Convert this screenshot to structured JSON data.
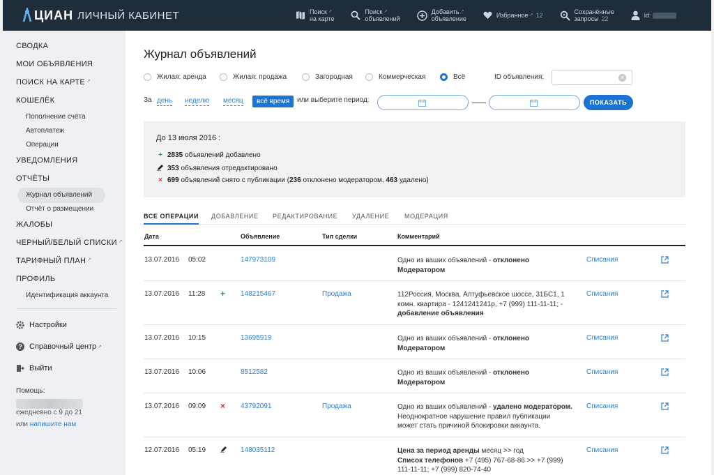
{
  "header": {
    "brand": "ЦИАН",
    "subtitle": "ЛИЧНЫЙ КАБИНЕТ",
    "nav": [
      {
        "icon": "map-icon",
        "line1": "Поиск",
        "line2": "на карте",
        "sup": "↗"
      },
      {
        "icon": "search-icon",
        "line1": "Поиск",
        "line2": "объявлений",
        "sup": "↗"
      },
      {
        "icon": "plus-circle-icon",
        "line1": "Добавить",
        "line2": "объявление",
        "sup": "↗"
      },
      {
        "icon": "heart-icon",
        "line1": "Избранное",
        "line2": "",
        "sup": "↗",
        "count": "12"
      },
      {
        "icon": "saved-search-icon",
        "line1": "Сохранённые",
        "line2": "запросы",
        "count": "22"
      },
      {
        "icon": "user-icon",
        "line1": "id:",
        "line2": ""
      }
    ]
  },
  "sidebar": {
    "items": [
      {
        "label": "СВОДКА"
      },
      {
        "label": "МОИ ОБЪЯВЛЕНИЯ"
      },
      {
        "label": "ПОИСК НА КАРТЕ",
        "sup": "↗"
      },
      {
        "label": "КОШЕЛЁК"
      },
      {
        "label": "Пополнение счёта"
      },
      {
        "label": "Автоплатеж"
      },
      {
        "label": "Операции"
      },
      {
        "label": "УВЕДОМЛЕНИЯ"
      },
      {
        "label": "ОТЧЁТЫ"
      },
      {
        "label": "Журнал объявлений"
      },
      {
        "label": "Отчёт о размещении"
      },
      {
        "label": "ЖАЛОБЫ"
      },
      {
        "label": "ЧЕРНЫЙ/БЕЛЫЙ СПИСКИ",
        "sup": "↗"
      },
      {
        "label": "ТАРИФНЫЙ ПЛАН",
        "sup": "↗"
      },
      {
        "label": "ПРОФИЛЬ"
      },
      {
        "label": "Идентификация аккаунта"
      }
    ],
    "tools": [
      {
        "icon": "gear-icon",
        "label": "Настройки"
      },
      {
        "icon": "help-icon",
        "label": "Справочный центр",
        "sup": "↗"
      },
      {
        "icon": "exit-icon",
        "label": "Выйти"
      }
    ],
    "help": {
      "title": "Помощь:",
      "hours": "ежедневно с 9 до 21",
      "or": "или",
      "write_link": "напишите нам"
    }
  },
  "main": {
    "title": "Журнал объявлений",
    "filters": [
      {
        "label": "Жилая: аренда",
        "checked": false
      },
      {
        "label": "Жилая: продажа",
        "checked": false
      },
      {
        "label": "Загородная",
        "checked": false
      },
      {
        "label": "Коммерческая",
        "checked": false
      },
      {
        "label": "Всё",
        "checked": true
      }
    ],
    "id_label": "ID объявления:",
    "id_value": "",
    "period": {
      "prefix": "За",
      "day": "день",
      "week": "неделю",
      "month": "месяц",
      "all": "всё время",
      "or_select": "или выберите период:",
      "show_button": "ПОКАЗАТЬ"
    },
    "summary": {
      "date": "До 13 июля 2016 :",
      "added_count": "2835",
      "added_text": "объявлений добавлено",
      "edited_count": "353",
      "edited_text": "объявления отредактировано",
      "removed_count": "699",
      "removed_text": "объявлений снято с публикации (",
      "rejected_count": "236",
      "rejected_text": "отклонено модератором,",
      "deleted_count": "463",
      "deleted_text": "удалено)"
    },
    "tabs": [
      "ВСЕ ОПЕРАЦИИ",
      "ДОБАВЛЕНИЕ",
      "РЕДАКТИРОВАНИЕ",
      "УДАЛЕНИЕ",
      "МОДЕРАЦИЯ"
    ],
    "columns": [
      "Дата",
      "Объявление",
      "Тип сделки",
      "Комментарий"
    ],
    "rows": [
      {
        "date": "13.07.2016",
        "time": "05:02",
        "mark": "",
        "id": "147973109",
        "deal": "",
        "c1": "Одно из ваших объявлений - ",
        "c1b": "отклонено",
        "c2b": "Модератором",
        "c3": "",
        "writeoff": "Списания"
      },
      {
        "date": "13.07.2016",
        "time": "11:28",
        "mark": "+",
        "id": "148215467",
        "deal": "Продажа",
        "c1": "112Россия, Москва, Алтуфьевское шоссе, 31БС1, 1",
        "c2": "комн. квартира - 1241241241р, +7 (999) 111-11-11; -",
        "c3b": "добавление объявления",
        "writeoff": "Списания"
      },
      {
        "date": "13.07.2016",
        "time": "10:15",
        "mark": "",
        "id": "13695919",
        "deal": "",
        "c1": "Одно из ваших объявлений - ",
        "c1b": "отклонено",
        "c2b": "Модератором",
        "writeoff": "Списания"
      },
      {
        "date": "13.07.2016",
        "time": "10:06",
        "mark": "",
        "id": "8512582",
        "deal": "",
        "c1": "Одно из ваших объявлений - ",
        "c1b": "отклонено",
        "c2b": "Модератором",
        "writeoff": "Списания"
      },
      {
        "date": "13.07.2016",
        "time": "09:09",
        "mark": "×",
        "id": "43792091",
        "deal": "Продажа",
        "c1": "Одно из ваших объявлений - ",
        "c1b": "удалено модератором.",
        "c2": "Неоднократное нарушение правил публикации",
        "c3": "может стать причиной блокировки аккаунта.",
        "writeoff": "Списания"
      },
      {
        "date": "12.07.2016",
        "time": "05:19",
        "mark": "✎",
        "id": "148035112",
        "deal": "",
        "c1b": "Цена за период аренды",
        "c1": " месяц >> год",
        "c2b": "Список телефонов",
        "c2": " +7 (495) 767-68-86 >> +7 (999)",
        "c3": "111-11-11; +7 (999) 820-74-40",
        "writeoff": "Списания"
      }
    ]
  }
}
